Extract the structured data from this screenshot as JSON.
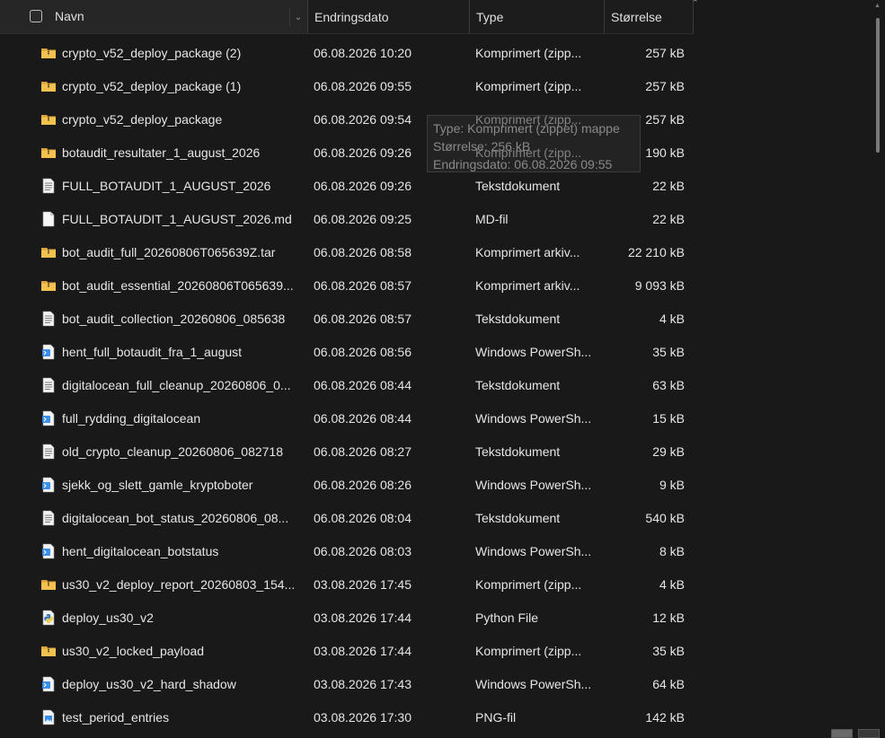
{
  "header": {
    "name": "Navn",
    "date": "Endringsdato",
    "type": "Type",
    "size": "Størrelse"
  },
  "rows": [
    {
      "name": "crypto_v52_deploy_package (2)",
      "date": "06.08.2026 10:20",
      "type": "Komprimert (zipp...",
      "size": "257 kB",
      "icon": "zip-folder-icon"
    },
    {
      "name": "crypto_v52_deploy_package (1)",
      "date": "06.08.2026 09:55",
      "type": "Komprimert (zipp...",
      "size": "257 kB",
      "icon": "zip-folder-icon"
    },
    {
      "name": "crypto_v52_deploy_package",
      "date": "06.08.2026 09:54",
      "type": "Komprimert (zipp...",
      "size": "257 kB",
      "icon": "zip-folder-icon"
    },
    {
      "name": "botaudit_resultater_1_august_2026",
      "date": "06.08.2026 09:26",
      "type": "Komprimert (zipp...",
      "size": "190 kB",
      "icon": "zip-folder-icon"
    },
    {
      "name": "FULL_BOTAUDIT_1_AUGUST_2026",
      "date": "06.08.2026 09:26",
      "type": "Tekstdokument",
      "size": "22 kB",
      "icon": "text-file-icon"
    },
    {
      "name": "FULL_BOTAUDIT_1_AUGUST_2026.md",
      "date": "06.08.2026 09:25",
      "type": "MD-fil",
      "size": "22 kB",
      "icon": "blank-file-icon"
    },
    {
      "name": "bot_audit_full_20260806T065639Z.tar",
      "date": "06.08.2026 08:58",
      "type": "Komprimert arkiv...",
      "size": "22 210 kB",
      "icon": "zip-folder-icon"
    },
    {
      "name": "bot_audit_essential_20260806T065639...",
      "date": "06.08.2026 08:57",
      "type": "Komprimert arkiv...",
      "size": "9 093 kB",
      "icon": "zip-folder-icon"
    },
    {
      "name": "bot_audit_collection_20260806_085638",
      "date": "06.08.2026 08:57",
      "type": "Tekstdokument",
      "size": "4 kB",
      "icon": "text-file-icon"
    },
    {
      "name": "hent_full_botaudit_fra_1_august",
      "date": "06.08.2026 08:56",
      "type": "Windows PowerSh...",
      "size": "35 kB",
      "icon": "powershell-file-icon"
    },
    {
      "name": "digitalocean_full_cleanup_20260806_0...",
      "date": "06.08.2026 08:44",
      "type": "Tekstdokument",
      "size": "63 kB",
      "icon": "text-file-icon"
    },
    {
      "name": "full_rydding_digitalocean",
      "date": "06.08.2026 08:44",
      "type": "Windows PowerSh...",
      "size": "15 kB",
      "icon": "powershell-file-icon"
    },
    {
      "name": "old_crypto_cleanup_20260806_082718",
      "date": "06.08.2026 08:27",
      "type": "Tekstdokument",
      "size": "29 kB",
      "icon": "text-file-icon"
    },
    {
      "name": "sjekk_og_slett_gamle_kryptoboter",
      "date": "06.08.2026 08:26",
      "type": "Windows PowerSh...",
      "size": "9 kB",
      "icon": "powershell-file-icon"
    },
    {
      "name": "digitalocean_bot_status_20260806_08...",
      "date": "06.08.2026 08:04",
      "type": "Tekstdokument",
      "size": "540 kB",
      "icon": "text-file-icon"
    },
    {
      "name": "hent_digitalocean_botstatus",
      "date": "06.08.2026 08:03",
      "type": "Windows PowerSh...",
      "size": "8 kB",
      "icon": "powershell-file-icon"
    },
    {
      "name": "us30_v2_deploy_report_20260803_154...",
      "date": "03.08.2026 17:45",
      "type": "Komprimert (zipp...",
      "size": "4 kB",
      "icon": "zip-folder-icon"
    },
    {
      "name": "deploy_us30_v2",
      "date": "03.08.2026 17:44",
      "type": "Python File",
      "size": "12 kB",
      "icon": "python-file-icon"
    },
    {
      "name": "us30_v2_locked_payload",
      "date": "03.08.2026 17:44",
      "type": "Komprimert (zipp...",
      "size": "35 kB",
      "icon": "zip-folder-icon"
    },
    {
      "name": "deploy_us30_v2_hard_shadow",
      "date": "03.08.2026 17:43",
      "type": "Windows PowerSh...",
      "size": "64 kB",
      "icon": "powershell-file-icon"
    },
    {
      "name": "test_period_entries",
      "date": "03.08.2026 17:30",
      "type": "PNG-fil",
      "size": "142 kB",
      "icon": "image-file-icon"
    }
  ],
  "tooltip": {
    "type": "Type: Komprimert (zippet) mappe",
    "size": "Størrelse: 256 kB",
    "date": "Endringsdato: 06.08.2026 09:55"
  },
  "colors": {
    "background": "#191919",
    "text": "#e6e6e6",
    "folder": "#e8b23c",
    "powershell": "#3a8ee6"
  }
}
